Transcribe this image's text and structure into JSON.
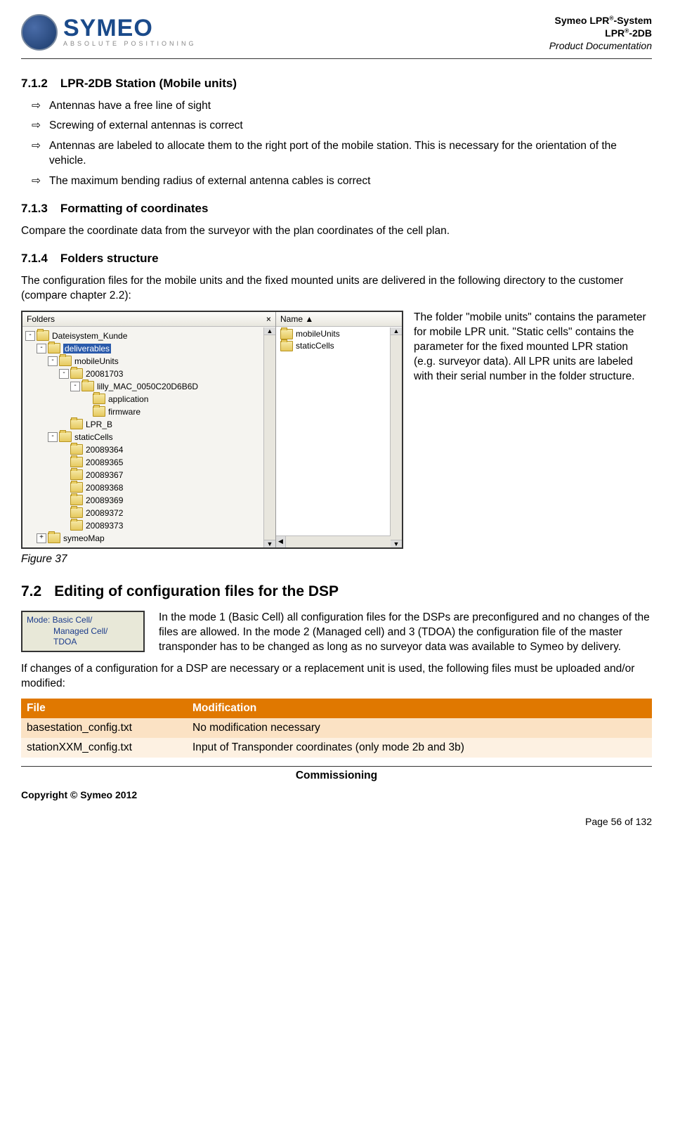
{
  "header": {
    "logo_main": "SYMEO",
    "logo_sub": "ABSOLUTE POSITIONING",
    "line1a": "Symeo LPR",
    "line1b": "-System",
    "line2a": "LPR",
    "line2b": "-2DB",
    "line3": "Product Documentation",
    "sup": "®"
  },
  "s712": {
    "num": "7.1.2",
    "title": "LPR-2DB Station (Mobile units)"
  },
  "bullets712": [
    "Antennas have a free line of sight",
    "Screwing of external antennas is correct",
    "Antennas are labeled to allocate them to the right port of the mobile station. This is necessary for the orientation of the vehicle.",
    "The maximum bending radius of external antenna cables is correct"
  ],
  "s713": {
    "num": "7.1.3",
    "title": "Formatting of coordinates"
  },
  "p713": "Compare the coordinate data from the surveyor with the plan coordinates of the cell plan.",
  "s714": {
    "num": "7.1.4",
    "title": "Folders structure"
  },
  "p714": "The configuration files for the mobile units and the fixed mounted units are delivered in the following directory to the customer (compare chapter 2.2):",
  "folders": {
    "left_header": "Folders",
    "close": "×",
    "right_header": "Name  ▲",
    "tree": [
      {
        "indent": 0,
        "toggle": "-",
        "name": "Dateisystem_Kunde",
        "sel": false
      },
      {
        "indent": 1,
        "toggle": "-",
        "name": "deliverables",
        "sel": true
      },
      {
        "indent": 2,
        "toggle": "-",
        "name": "mobileUnits",
        "sel": false
      },
      {
        "indent": 3,
        "toggle": "-",
        "name": "20081703",
        "sel": false
      },
      {
        "indent": 4,
        "toggle": "-",
        "name": "lilly_MAC_0050C20D6B6D",
        "sel": false
      },
      {
        "indent": 5,
        "toggle": "",
        "name": "application",
        "sel": false
      },
      {
        "indent": 5,
        "toggle": "",
        "name": "firmware",
        "sel": false
      },
      {
        "indent": 3,
        "toggle": "",
        "name": "LPR_B",
        "sel": false
      },
      {
        "indent": 2,
        "toggle": "-",
        "name": "staticCells",
        "sel": false
      },
      {
        "indent": 3,
        "toggle": "",
        "name": "20089364",
        "sel": false
      },
      {
        "indent": 3,
        "toggle": "",
        "name": "20089365",
        "sel": false
      },
      {
        "indent": 3,
        "toggle": "",
        "name": "20089367",
        "sel": false
      },
      {
        "indent": 3,
        "toggle": "",
        "name": "20089368",
        "sel": false
      },
      {
        "indent": 3,
        "toggle": "",
        "name": "20089369",
        "sel": false
      },
      {
        "indent": 3,
        "toggle": "",
        "name": "20089372",
        "sel": false
      },
      {
        "indent": 3,
        "toggle": "",
        "name": "20089373",
        "sel": false
      },
      {
        "indent": 1,
        "toggle": "+",
        "name": "symeoMap",
        "sel": false
      }
    ],
    "right_list": [
      "mobileUnits",
      "staticCells"
    ]
  },
  "folder_side_text": "The folder \"mobile units\" contains the parameter for mobile LPR unit. \"Static cells\" contains the parameter for the fixed mounted LPR station (e.g. surveyor data). All LPR units are labeled with their serial number in the folder structure.",
  "fig37": "Figure 37",
  "s72": {
    "num": "7.2",
    "title": "Editing of configuration files for the DSP"
  },
  "mode_box": {
    "l1": "Mode: Basic Cell/",
    "l2": "Managed Cell/",
    "l3": "TDOA"
  },
  "p72a": "In the mode 1 (Basic Cell) all configuration files for the DSPs are preconfigured and no changes of the files are allowed. In the mode 2 (Managed cell) and 3 (TDOA) the configuration file of the master transponder has to be changed as long as no surveyor data was available to Symeo by delivery.",
  "p72b": "If changes of a configuration for a DSP are necessary or a replacement unit is used, the following files must be uploaded and/or modified:",
  "table": {
    "h1": "File",
    "h2": "Modification",
    "rows": [
      {
        "c1": "basestation_config.txt",
        "c2": "No modification necessary"
      },
      {
        "c1": "stationXXM_config.txt",
        "c2": "Input of Transponder coordinates (only mode 2b and 3b)"
      }
    ]
  },
  "footer": {
    "section": "Commissioning",
    "copyright": "Copyright © Symeo 2012",
    "page": "Page 56 of 132"
  },
  "marker": "⇨"
}
